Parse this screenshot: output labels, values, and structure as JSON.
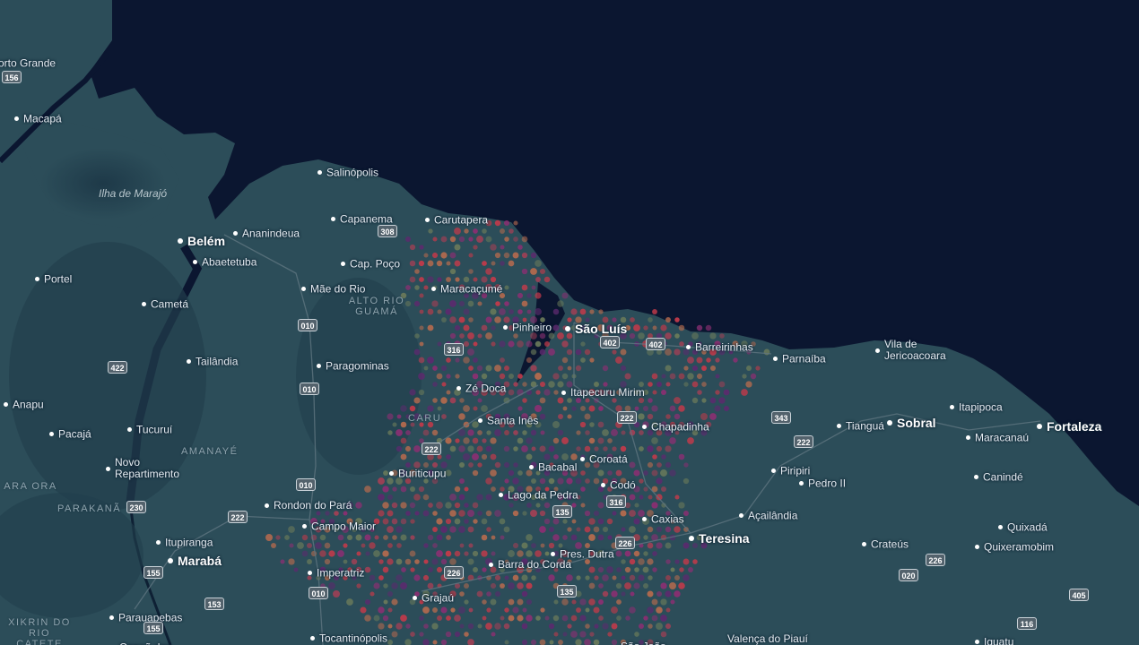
{
  "map": {
    "colors": {
      "ocean": "#0b1630",
      "land": "#2c4d59",
      "forest": "#203a49",
      "hex_palette": [
        "#c23a4a",
        "#8a2f72",
        "#b46a4e",
        "#6a7a5a",
        "#5c2a6e",
        "#a04055"
      ]
    },
    "cities": [
      {
        "name": "orto Grande",
        "major": false,
        "nodot": true
      },
      {
        "name": "Macapá",
        "major": false
      },
      {
        "name": "Salinópolis",
        "major": false
      },
      {
        "name": "Capanema",
        "major": false
      },
      {
        "name": "Carutapera",
        "major": false
      },
      {
        "name": "Belém",
        "major": true
      },
      {
        "name": "Ananindeua",
        "major": false
      },
      {
        "name": "Abaetetuba",
        "major": false
      },
      {
        "name": "Cap. Poço",
        "major": false
      },
      {
        "name": "Portel",
        "major": false
      },
      {
        "name": "Mãe do Rio",
        "major": false
      },
      {
        "name": "Maracaçumé",
        "major": false
      },
      {
        "name": "Cametá",
        "major": false
      },
      {
        "name": "Pinheiro",
        "major": false
      },
      {
        "name": "São Luís",
        "major": true
      },
      {
        "name": "Barreirinhas",
        "major": false
      },
      {
        "name": "Parnaíba",
        "major": false
      },
      {
        "name": "Vila de Jericoacoara",
        "major": false
      },
      {
        "name": "Tailândia",
        "major": false
      },
      {
        "name": "Paragominas",
        "major": false
      },
      {
        "name": "Zé Doca",
        "major": false
      },
      {
        "name": "Itapecuru Mirim",
        "major": false
      },
      {
        "name": "Anapu",
        "major": false
      },
      {
        "name": "Itapipoca",
        "major": false
      },
      {
        "name": "Santa Inês",
        "major": false
      },
      {
        "name": "Chapadinha",
        "major": false
      },
      {
        "name": "Tianguá",
        "major": false
      },
      {
        "name": "Sobral",
        "major": true
      },
      {
        "name": "Fortaleza",
        "major": true
      },
      {
        "name": "Pacajá",
        "major": false
      },
      {
        "name": "Tucuruí",
        "major": false
      },
      {
        "name": "Maracanaú",
        "major": false
      },
      {
        "name": "Coroatá",
        "major": false
      },
      {
        "name": "Novo Repartimento",
        "major": false
      },
      {
        "name": "Bacabal",
        "major": false
      },
      {
        "name": "Buriticupu",
        "major": false
      },
      {
        "name": "Piripiri",
        "major": false
      },
      {
        "name": "Pedro II",
        "major": false
      },
      {
        "name": "Canindé",
        "major": false
      },
      {
        "name": "Codó",
        "major": false
      },
      {
        "name": "Lago da Pedra",
        "major": false
      },
      {
        "name": "Rondon do Pará",
        "major": false
      },
      {
        "name": "Campo Maior",
        "major": false
      },
      {
        "name": "Açailândia",
        "major": false
      },
      {
        "name": "Caxias",
        "major": false
      },
      {
        "name": "Quixadá",
        "major": false
      },
      {
        "name": "Teresina",
        "major": true
      },
      {
        "name": "Itupiranga",
        "major": false
      },
      {
        "name": "Crateús",
        "major": false
      },
      {
        "name": "Quixeramobim",
        "major": false
      },
      {
        "name": "Marabá",
        "major": true
      },
      {
        "name": "Pres. Dutra",
        "major": false
      },
      {
        "name": "Imperatriz",
        "major": false
      },
      {
        "name": "Barra do Corda",
        "major": false
      },
      {
        "name": "Grajaú",
        "major": false
      },
      {
        "name": "Parauapebas",
        "major": false
      },
      {
        "name": "Tocantinópolis",
        "major": false
      },
      {
        "name": "Iguatu",
        "major": false
      },
      {
        "name": "Canaã dos",
        "major": false,
        "nodot": true
      },
      {
        "name": "São João",
        "major": false,
        "nodot": true
      },
      {
        "name": "Valença do Piauí",
        "major": false,
        "nodot": true
      }
    ],
    "regions": [
      "Ilha de Marajó",
      "ALTO RIO GUAMÁ",
      "CARU",
      "AMANAYÉ",
      "PARAKANÃ",
      "XIKRIN DO RIO CATETE",
      "ARA ORA"
    ],
    "shields": [
      "156",
      "308",
      "010",
      "316",
      "402",
      "402",
      "422",
      "010",
      "222",
      "343",
      "222",
      "222",
      "010",
      "230",
      "222",
      "135",
      "316",
      "226",
      "226",
      "155",
      "153",
      "010",
      "135",
      "155",
      "020",
      "226",
      "405",
      "116"
    ]
  }
}
